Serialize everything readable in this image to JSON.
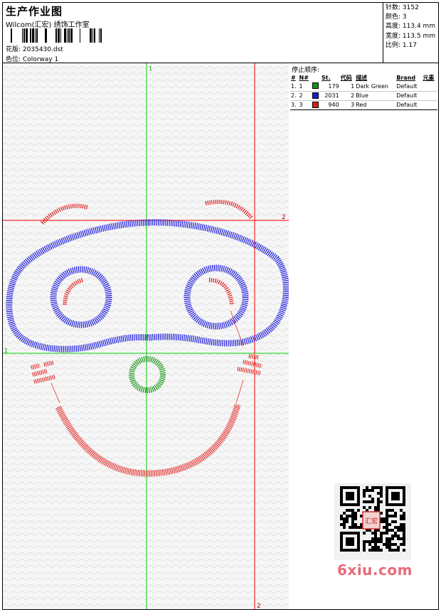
{
  "header": {
    "title": "生产作业图",
    "subtitle": "Wilcom(汇宏) 绣饰工作室",
    "design_label": "花版:",
    "design_value": "2035430.dst",
    "colorway_label": "色位:",
    "colorway_value": "Colorway 1"
  },
  "stats": [
    {
      "label": "针数:",
      "value": "3152"
    },
    {
      "label": "颜色:",
      "value": "3"
    },
    {
      "label": "高度:",
      "value": "113.4 mm"
    },
    {
      "label": "宽度:",
      "value": "113.5 mm"
    },
    {
      "label": "比例:",
      "value": "1.17"
    }
  ],
  "canvas": {
    "axis_labels": {
      "green_vertical_top": "1",
      "green_horizontal_left": "1",
      "red_horizontal_right": "2",
      "red_vertical_bottom": "2"
    },
    "guide_colors": {
      "green": "#00cc00",
      "red": "#ff0000"
    }
  },
  "stop_sequence": {
    "title": "停止顺序:",
    "columns": [
      "#",
      "N#",
      "St.",
      "代码",
      "描述",
      "Brand",
      "元素"
    ],
    "rows": [
      {
        "idx": "1.",
        "n": "1",
        "color": "#149314",
        "st": "179",
        "code": "1",
        "desc": "Dark Green",
        "brand": "Default",
        "element": ""
      },
      {
        "idx": "2.",
        "n": "2",
        "color": "#1a1adc",
        "st": "2031",
        "code": "2",
        "desc": "Blue",
        "brand": "Default",
        "element": ""
      },
      {
        "idx": "3.",
        "n": "3",
        "color": "#e01818",
        "st": "940",
        "code": "3",
        "desc": "Red",
        "brand": "Default",
        "element": ""
      }
    ]
  },
  "thread_colors": {
    "green": "#149314",
    "blue": "#1a1adc",
    "red": "#e01818"
  },
  "watermark": {
    "seal_text": "汇宏",
    "site": "6xiu.com"
  }
}
